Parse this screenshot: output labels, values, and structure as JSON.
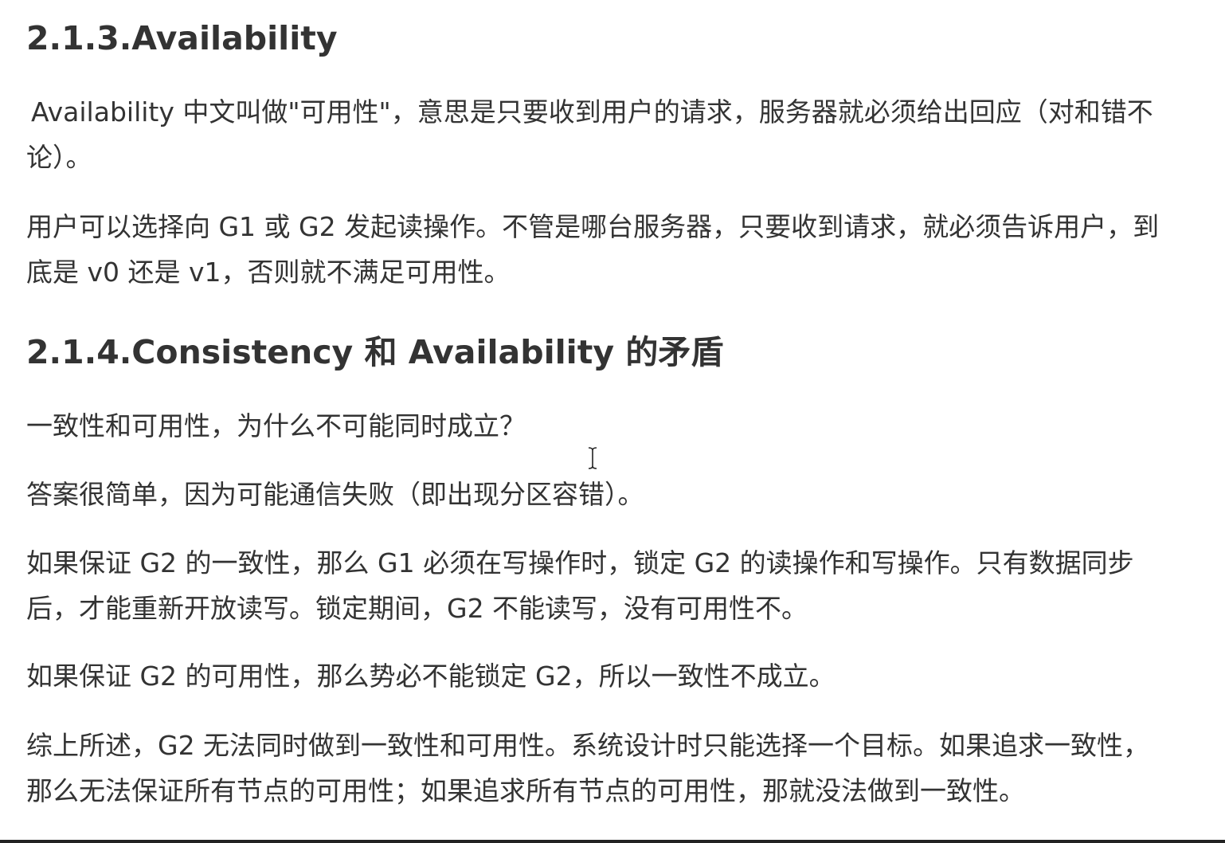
{
  "sections": {
    "availability": {
      "heading": "2.1.3.Availability",
      "paragraphs": [
        "Availability 中文叫做\"可用性\"，意思是只要收到用户的请求，服务器就必须给出回应（对和错不论）。",
        "用户可以选择向 G1 或 G2 发起读操作。不管是哪台服务器，只要收到请求，就必须告诉用户，到底是 v0 还是 v1，否则就不满足可用性。"
      ]
    },
    "conflict": {
      "heading": "2.1.4.Consistency 和 Availability 的矛盾",
      "paragraphs": [
        "一致性和可用性，为什么不可能同时成立？",
        "答案很简单，因为可能通信失败（即出现分区容错）。",
        "如果保证 G2 的一致性，那么 G1 必须在写操作时，锁定 G2 的读操作和写操作。只有数据同步后，才能重新开放读写。锁定期间，G2 不能读写，没有可用性不。",
        "如果保证 G2 的可用性，那么势必不能锁定 G2，所以一致性不成立。",
        "综上所述，G2 无法同时做到一致性和可用性。系统设计时只能选择一个目标。如果追求一致性，那么无法保证所有节点的可用性；如果追求所有节点的可用性，那就没法做到一致性。"
      ]
    }
  },
  "cursor": {
    "icon": "text-cursor-icon"
  }
}
